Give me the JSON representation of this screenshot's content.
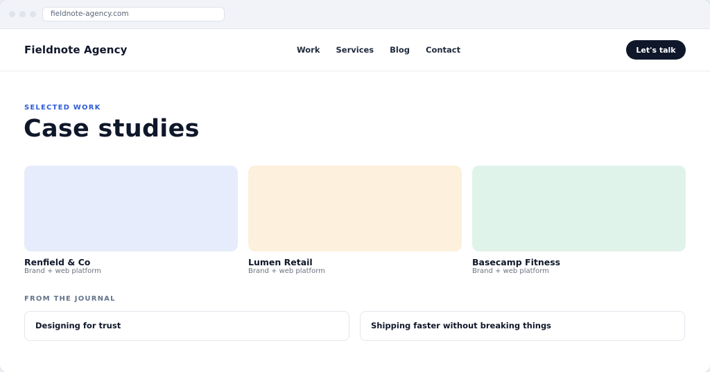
{
  "browser": {
    "url": "fieldnote-agency.com"
  },
  "header": {
    "brand": "Fieldnote Agency",
    "nav": [
      "Work",
      "Services",
      "Blog",
      "Contact"
    ],
    "cta_label": "Let's talk"
  },
  "hero": {
    "eyebrow": "SELECTED WORK",
    "title": "Case studies"
  },
  "cases": [
    {
      "title": "Renfield & Co",
      "subtitle": "Brand + web platform",
      "color": "#e6ecfb"
    },
    {
      "title": "Lumen Retail",
      "subtitle": "Brand + web platform",
      "color": "#fdf0dc"
    },
    {
      "title": "Basecamp Fitness",
      "subtitle": "Brand + web platform",
      "color": "#e0f3ea"
    }
  ],
  "journal": {
    "label": "FROM THE JOURNAL",
    "posts": [
      "Designing for trust",
      "Shipping faster without breaking things"
    ]
  }
}
